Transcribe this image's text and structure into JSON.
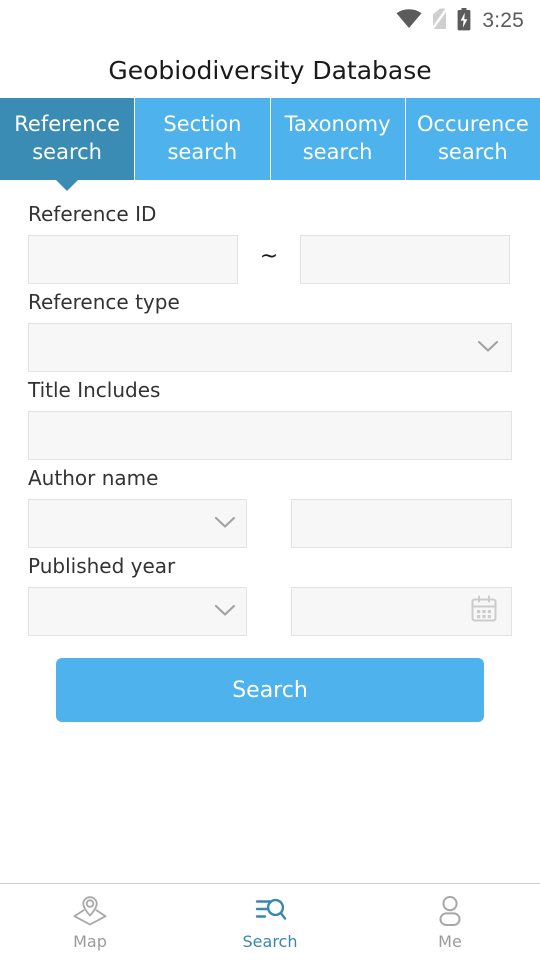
{
  "status_bar": {
    "time": "3:25",
    "icons": [
      "wifi-icon",
      "no-sim-icon",
      "battery-charging-icon"
    ]
  },
  "header": {
    "title": "Geobiodiversity Database"
  },
  "tabs": {
    "active_index": 0,
    "items": [
      {
        "line1": "Reference",
        "line2": "search"
      },
      {
        "line1": "Section",
        "line2": "search"
      },
      {
        "line1": "Taxonomy",
        "line2": "search"
      },
      {
        "line1": "Occurence",
        "line2": "search"
      }
    ]
  },
  "form": {
    "reference_id": {
      "label": "Reference ID",
      "from_value": "",
      "from_placeholder": "",
      "separator": "~",
      "to_value": "",
      "to_placeholder": ""
    },
    "reference_type": {
      "label": "Reference type",
      "selected": "",
      "placeholder": ""
    },
    "title_includes": {
      "label": "Title Includes",
      "value": "",
      "placeholder": ""
    },
    "author_name": {
      "label": "Author name",
      "selected": "",
      "value": "",
      "placeholder": ""
    },
    "published_year": {
      "label": "Published year",
      "selected": "",
      "value": "",
      "placeholder": ""
    }
  },
  "actions": {
    "search_label": "Search"
  },
  "bottom_nav": {
    "active_index": 1,
    "items": [
      {
        "label": "Map",
        "icon": "map-pin-layers-icon"
      },
      {
        "label": "Search",
        "icon": "search-list-icon"
      },
      {
        "label": "Me",
        "icon": "person-icon"
      }
    ]
  },
  "colors": {
    "tab_active": "#3a8cb5",
    "tab_inactive": "#4eb2ec",
    "accent": "#4eb2ec",
    "nav_active": "#3a86b3",
    "input_bg": "#f7f7f7",
    "input_border": "#e3e3e3"
  }
}
